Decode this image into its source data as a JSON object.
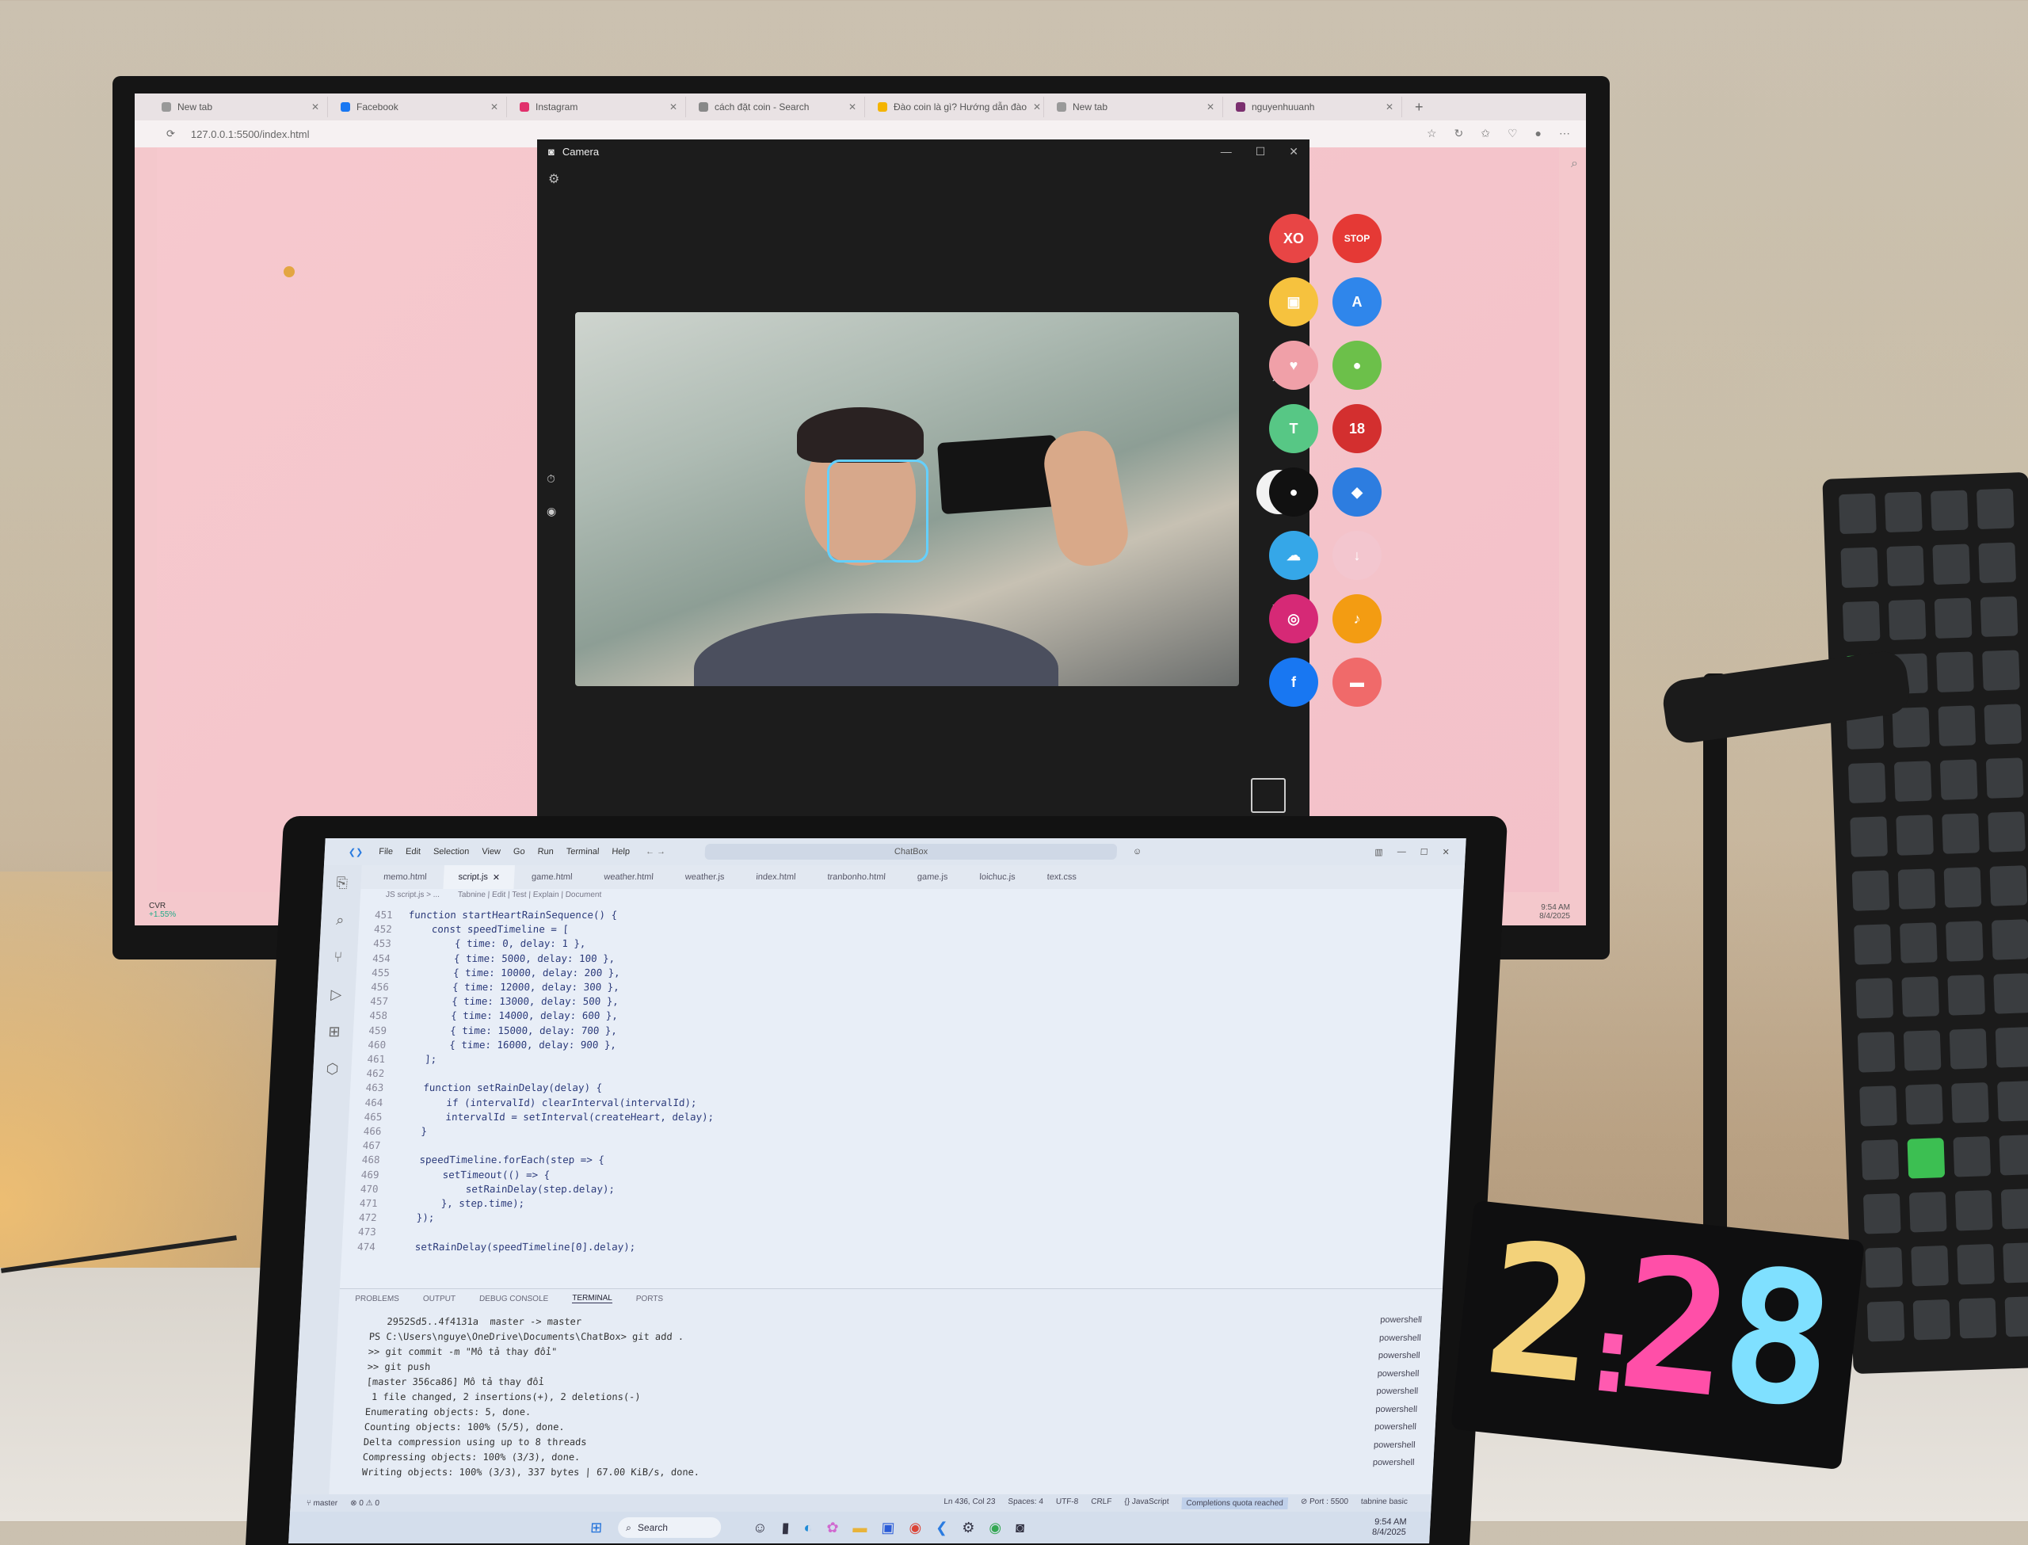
{
  "browser": {
    "tabs": [
      {
        "label": "New tab",
        "color": "#999999"
      },
      {
        "label": "Facebook",
        "color": "#1877f2"
      },
      {
        "label": "Instagram",
        "color": "#e1306c"
      },
      {
        "label": "cách đặt coin - Search",
        "color": "#888888"
      },
      {
        "label": "Đào coin là gì? Hướng dẫn đào",
        "color": "#f4b400"
      },
      {
        "label": "New tab",
        "color": "#999999"
      },
      {
        "label": "nguyenhuuanh",
        "color": "#7b2f6f"
      }
    ],
    "url": "127.0.0.1:5500/index.html",
    "taskbar_left_label": "CVR",
    "taskbar_left_sub": "+1.55%",
    "clock_time": "9:54 AM",
    "clock_date": "8/4/2025"
  },
  "camera": {
    "title": "Camera"
  },
  "apps": [
    {
      "name": "tictactoe-icon",
      "glyph": "XO",
      "color": "#e84545"
    },
    {
      "name": "stop-icon",
      "glyph": "STOP",
      "color": "#e53935"
    },
    {
      "name": "photo-booth-icon",
      "glyph": "▣",
      "color": "#f6c23e"
    },
    {
      "name": "translate-icon",
      "glyph": "A",
      "color": "#2f86eb"
    },
    {
      "name": "anatomy-icon",
      "glyph": "♥",
      "color": "#f0a0a8"
    },
    {
      "name": "flappy-bird-icon",
      "glyph": "●",
      "color": "#6cc04a"
    },
    {
      "name": "gift-icon",
      "glyph": "T",
      "color": "#57c785"
    },
    {
      "name": "age-18-icon",
      "glyph": "18",
      "color": "#d32f2f"
    },
    {
      "name": "profile-icon",
      "glyph": "●",
      "color": "#111111"
    },
    {
      "name": "gamepad-icon",
      "glyph": "◆",
      "color": "#2d7de0"
    },
    {
      "name": "weather-icon",
      "glyph": "☁",
      "color": "#35a7e8"
    },
    {
      "name": "download-icon",
      "glyph": "↓",
      "color": "#f3c6cf"
    },
    {
      "name": "instagram-icon",
      "glyph": "◎",
      "color": "#d62976"
    },
    {
      "name": "sound-icon",
      "glyph": "♪",
      "color": "#f39c12"
    },
    {
      "name": "facebook-icon",
      "glyph": "f",
      "color": "#1877f2"
    },
    {
      "name": "chat-icon",
      "glyph": "▬",
      "color": "#f06a6a"
    }
  ],
  "vscode": {
    "menu": [
      "File",
      "Edit",
      "Selection",
      "View",
      "Go",
      "Run",
      "Terminal",
      "Help"
    ],
    "search": "ChatBox",
    "tabs": [
      "memo.html",
      "script.js",
      "game.html",
      "weather.html",
      "weather.js",
      "index.html",
      "tranbonho.html",
      "game.js",
      "loichuc.js",
      "text.css"
    ],
    "breadcrumb": "JS script.js > ...",
    "codelens": "Tabnine | Edit | Test | Explain | Document",
    "code": [
      {
        "n": "451",
        "t": "function startHeartRainSequence() {"
      },
      {
        "n": "452",
        "t": "    const speedTimeline = ["
      },
      {
        "n": "453",
        "t": "        { time: 0, delay: 1 },"
      },
      {
        "n": "454",
        "t": "        { time: 5000, delay: 100 },"
      },
      {
        "n": "455",
        "t": "        { time: 10000, delay: 200 },"
      },
      {
        "n": "456",
        "t": "        { time: 12000, delay: 300 },"
      },
      {
        "n": "457",
        "t": "        { time: 13000, delay: 500 },"
      },
      {
        "n": "458",
        "t": "        { time: 14000, delay: 600 },"
      },
      {
        "n": "459",
        "t": "        { time: 15000, delay: 700 },"
      },
      {
        "n": "460",
        "t": "        { time: 16000, delay: 900 },"
      },
      {
        "n": "461",
        "t": "    ];"
      },
      {
        "n": "462",
        "t": ""
      },
      {
        "n": "463",
        "t": "    function setRainDelay(delay) {"
      },
      {
        "n": "464",
        "t": "        if (intervalId) clearInterval(intervalId);"
      },
      {
        "n": "465",
        "t": "        intervalId = setInterval(createHeart, delay);"
      },
      {
        "n": "466",
        "t": "    }"
      },
      {
        "n": "467",
        "t": ""
      },
      {
        "n": "468",
        "t": "    speedTimeline.forEach(step => {"
      },
      {
        "n": "469",
        "t": "        setTimeout(() => {"
      },
      {
        "n": "470",
        "t": "            setRainDelay(step.delay);"
      },
      {
        "n": "471",
        "t": "        }, step.time);"
      },
      {
        "n": "472",
        "t": "    });"
      },
      {
        "n": "473",
        "t": ""
      },
      {
        "n": "474",
        "t": "    setRainDelay(speedTimeline[0].delay);"
      }
    ],
    "panel_tabs": [
      "PROBLEMS",
      "OUTPUT",
      "DEBUG CONSOLE",
      "TERMINAL",
      "PORTS"
    ],
    "terminal": [
      "   2952Sd5..4f4131a  master -> master",
      "PS C:\\Users\\nguye\\OneDrive\\Documents\\ChatBox> git add .",
      ">> git commit -m \"Mô tả thay đổi\"",
      ">> git push",
      "[master 356ca86] Mô tả thay đổi",
      " 1 file changed, 2 insertions(+), 2 deletions(-)",
      "Enumerating objects: 5, done.",
      "Counting objects: 100% (5/5), done.",
      "Delta compression using up to 8 threads",
      "Compressing objects: 100% (3/3), done.",
      "Writing objects: 100% (3/3), 337 bytes | 67.00 KiB/s, done."
    ],
    "shells": [
      "powershell",
      "powershell",
      "powershell",
      "powershell",
      "powershell",
      "powershell",
      "powershell",
      "powershell",
      "powershell"
    ],
    "status_left": "master",
    "status_errors": "⊗ 0 ⚠ 0",
    "status_items": [
      "Ln 436, Col 23",
      "Spaces: 4",
      "UTF-8",
      "CRLF",
      "{} JavaScript",
      "Completions quota reached",
      "⊘ Port : 5500",
      "tabnine basic"
    ],
    "taskbar_search": "Search",
    "clock_time": "9:54 AM",
    "clock_date": "8/4/2025"
  },
  "led_clock": {
    "digits": [
      "2",
      ":",
      "2",
      "8"
    ],
    "colors": [
      "#f3d27a",
      "#ff5ab0",
      "#ff4fa8",
      "#7fe0ff"
    ]
  }
}
